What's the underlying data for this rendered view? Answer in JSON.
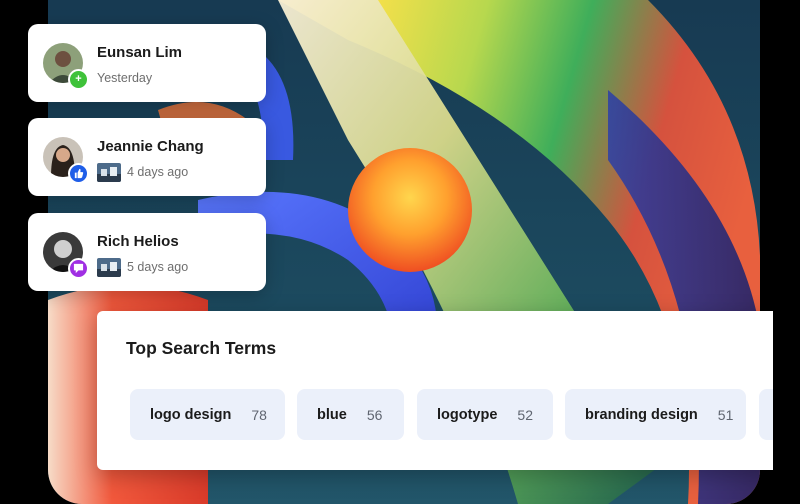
{
  "activity": [
    {
      "name": "Eunsan Lim",
      "time": "Yesterday",
      "badge": "follow",
      "badge_color": "#3fc23a",
      "badge_glyph": "+",
      "has_thumb": false
    },
    {
      "name": "Jeannie Chang",
      "time": "4 days ago",
      "badge": "like",
      "badge_color": "#1f5ee8",
      "badge_glyph": "👍",
      "has_thumb": true
    },
    {
      "name": "Rich Helios",
      "time": "5 days ago",
      "badge": "comment",
      "badge_color": "#a02fe3",
      "badge_glyph": "▾",
      "has_thumb": true
    }
  ],
  "search_terms": {
    "title": "Top Search Terms",
    "items": [
      {
        "term": "logo design",
        "count": "78"
      },
      {
        "term": "blue",
        "count": "56"
      },
      {
        "term": "logotype",
        "count": "52"
      },
      {
        "term": "branding design",
        "count": "51"
      }
    ]
  },
  "colors": {
    "chip_bg": "#ebf0fa",
    "follow": "#3fc23a",
    "like": "#1f5ee8",
    "comment": "#a02fe3"
  }
}
